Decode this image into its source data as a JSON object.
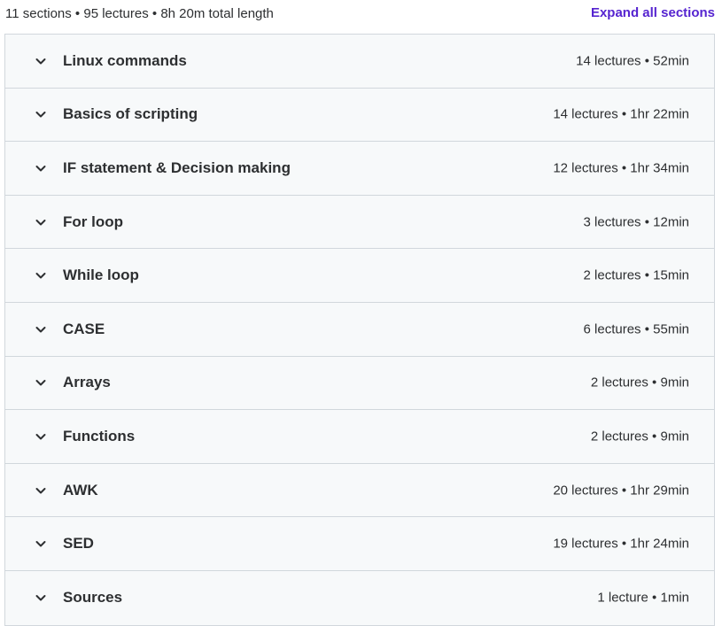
{
  "summary": {
    "text": "11 sections • 95 lectures • 8h 20m total length",
    "expand_all_label": "Expand all sections"
  },
  "colors": {
    "accent": "#5624d0",
    "row_background": "#f7f9fa",
    "border": "#d1d7dc",
    "text": "#2d2f31"
  },
  "sections": [
    {
      "title": "Linux commands",
      "meta": "14 lectures • 52min",
      "icon": "chevron-down-icon"
    },
    {
      "title": "Basics of scripting",
      "meta": "14 lectures • 1hr 22min",
      "icon": "chevron-down-icon"
    },
    {
      "title": "IF statement & Decision making",
      "meta": "12 lectures • 1hr 34min",
      "icon": "chevron-down-icon"
    },
    {
      "title": "For loop",
      "meta": "3 lectures • 12min",
      "icon": "chevron-down-icon"
    },
    {
      "title": "While loop",
      "meta": "2 lectures • 15min",
      "icon": "chevron-down-icon"
    },
    {
      "title": "CASE",
      "meta": "6 lectures • 55min",
      "icon": "chevron-down-icon"
    },
    {
      "title": "Arrays",
      "meta": "2 lectures • 9min",
      "icon": "chevron-down-icon"
    },
    {
      "title": "Functions",
      "meta": "2 lectures • 9min",
      "icon": "chevron-down-icon"
    },
    {
      "title": "AWK",
      "meta": "20 lectures • 1hr 29min",
      "icon": "chevron-down-icon"
    },
    {
      "title": "SED",
      "meta": "19 lectures • 1hr 24min",
      "icon": "chevron-down-icon"
    },
    {
      "title": "Sources",
      "meta": "1 lecture • 1min",
      "icon": "chevron-down-icon"
    }
  ]
}
